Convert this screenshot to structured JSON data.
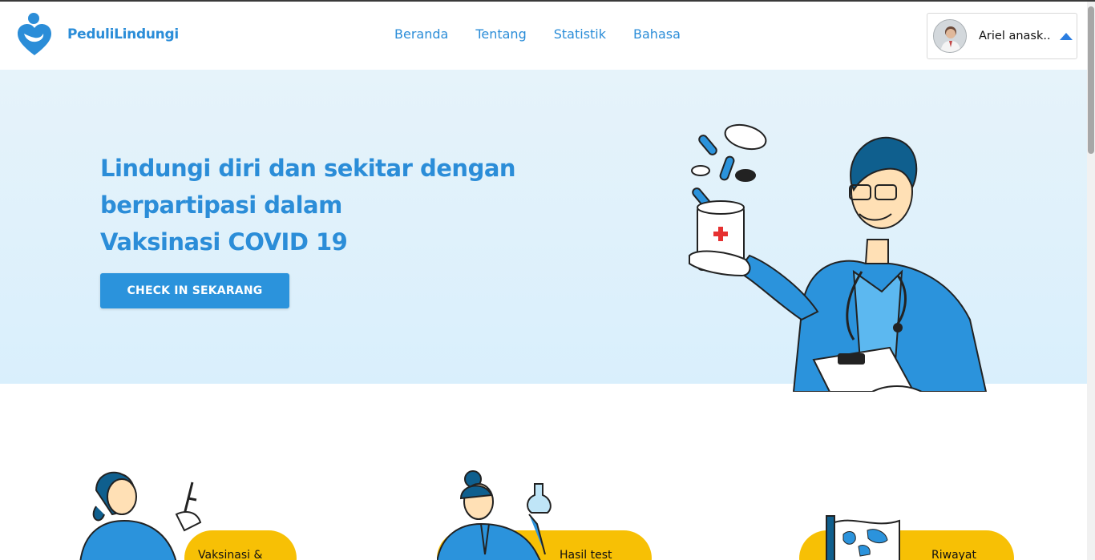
{
  "brand": {
    "name": "PeduliLindungi",
    "logo_icon": "heart-hands-logo-icon",
    "color": "#2b8dd8"
  },
  "nav": {
    "items": [
      {
        "label": "Beranda"
      },
      {
        "label": "Tentang"
      },
      {
        "label": "Statistik"
      },
      {
        "label": "Bahasa"
      }
    ]
  },
  "user": {
    "name": "Ariel anask..",
    "avatar_icon": "user-avatar",
    "caret_icon": "caret-up-icon",
    "caret_color": "#2b7de0"
  },
  "hero": {
    "title_lines": [
      "Lindungi diri dan sekitar dengan",
      "berpartipasi dalam",
      "Vaksinasi COVID 19"
    ],
    "cta_label": "CHECK IN SEKARANG",
    "illustration_icon": "doctor-with-pills-illustration",
    "accent": "#2b93dc"
  },
  "cards": [
    {
      "label": "Vaksinasi &",
      "icon": "nurse-syringe-illustration"
    },
    {
      "label": "Hasil test",
      "icon": "scientist-flask-illustration"
    },
    {
      "label": "Riwayat",
      "icon": "world-map-flag-illustration"
    }
  ],
  "colors": {
    "card_accent": "#f7c005",
    "hero_bg": "#ddf0fb"
  }
}
